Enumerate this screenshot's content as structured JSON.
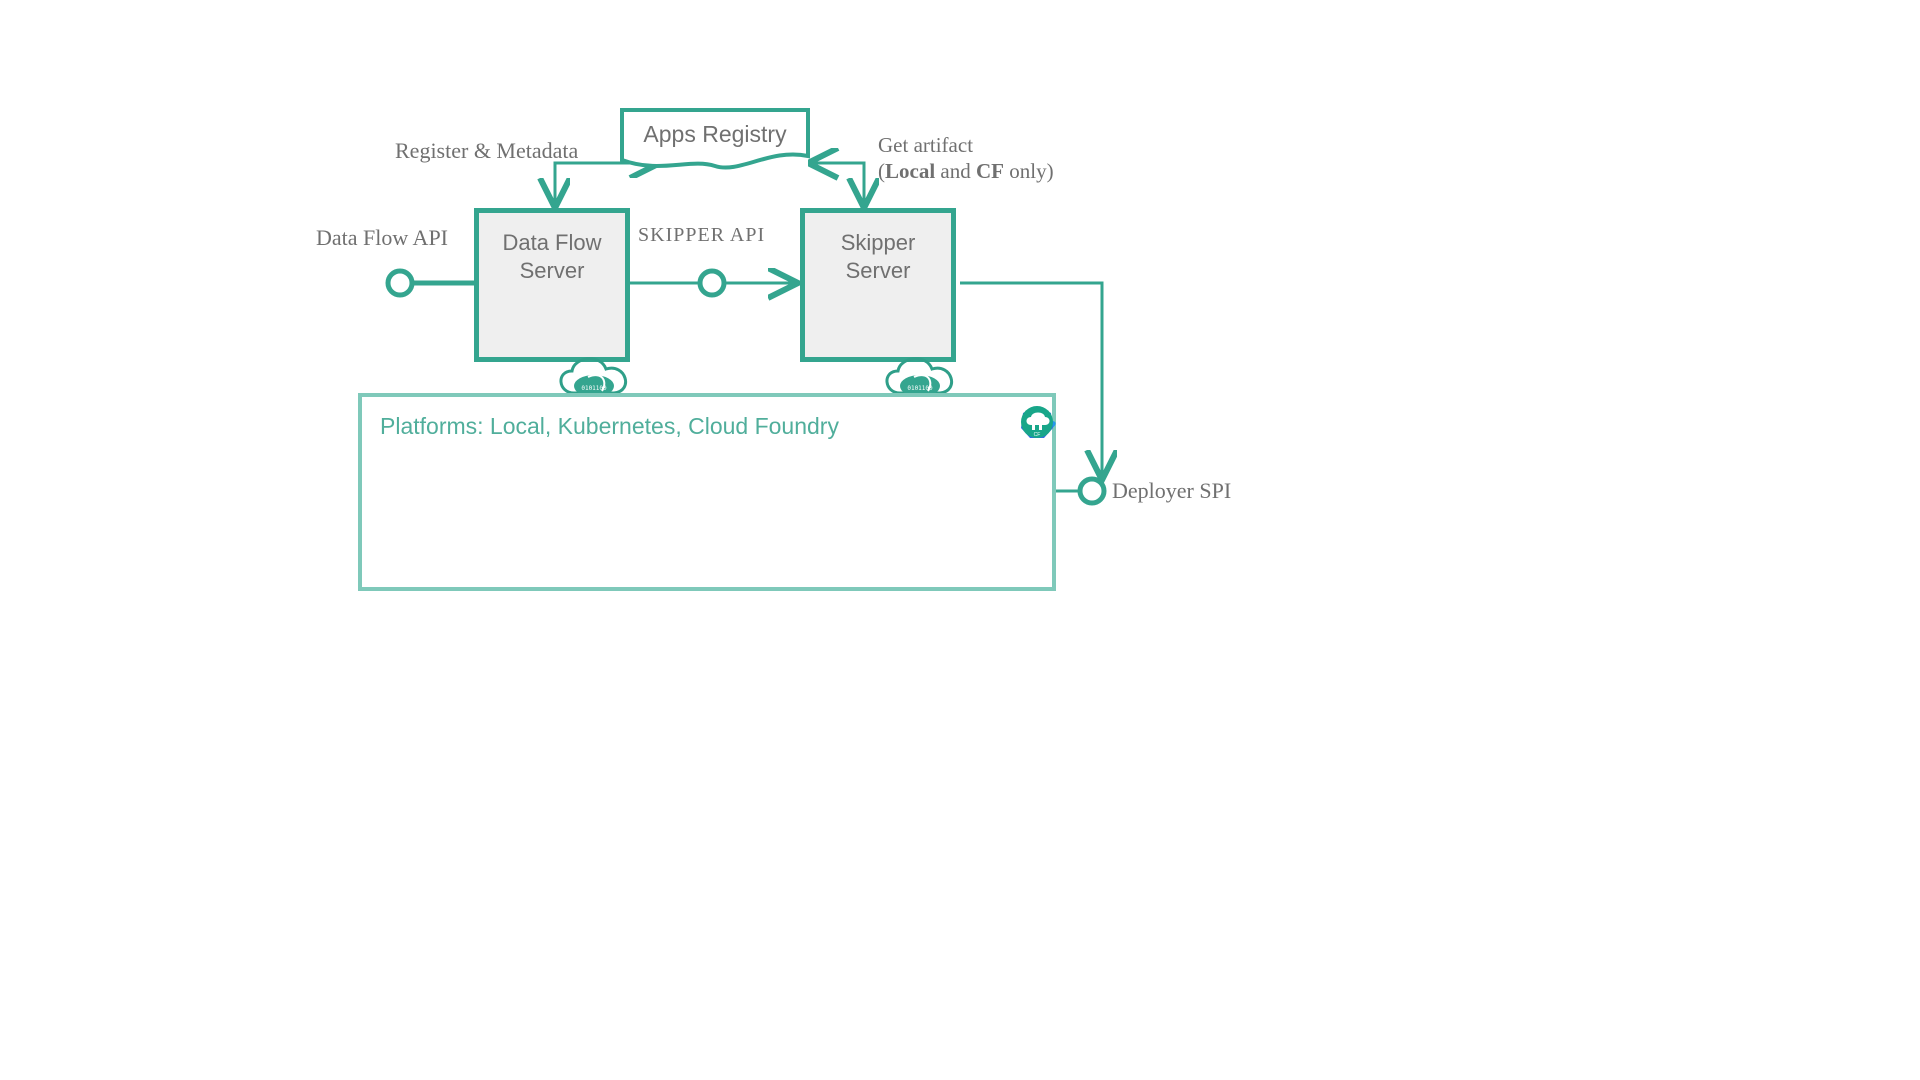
{
  "labels": {
    "data_flow_api": "Data Flow API",
    "register_metadata": "Register & Metadata",
    "skipper_api": "SKIPPER API",
    "get_artifact_line1": "Get artifact",
    "get_artifact_line2_prefix": "(",
    "get_artifact_line2_local": "Local",
    "get_artifact_line2_mid": " and ",
    "get_artifact_line2_cf": "CF",
    "get_artifact_line2_suffix": " only)",
    "deployer_spi": "Deployer SPI"
  },
  "boxes": {
    "apps_registry": "Apps Registry",
    "data_flow_server_l1": "Data Flow",
    "data_flow_server_l2": "Server",
    "skipper_server_l1": "Skipper",
    "skipper_server_l2": "Server",
    "platforms": "Platforms:  Local, Kubernetes, Cloud Foundry"
  },
  "icons": {
    "cloud1": "spring-cloud-icon",
    "cloud2": "spring-cloud-icon",
    "docker": "docker-icon",
    "k8s": "kubernetes-icon",
    "cf": "cloud-foundry-icon"
  },
  "colors": {
    "accent": "#34a58f",
    "accent_light": "#7fc9ba",
    "box_fill": "#efefef",
    "text_grey": "#707070",
    "docker_blue": "#2496ed",
    "k8s_blue": "#326ce5",
    "cf_green": "#18a689"
  }
}
